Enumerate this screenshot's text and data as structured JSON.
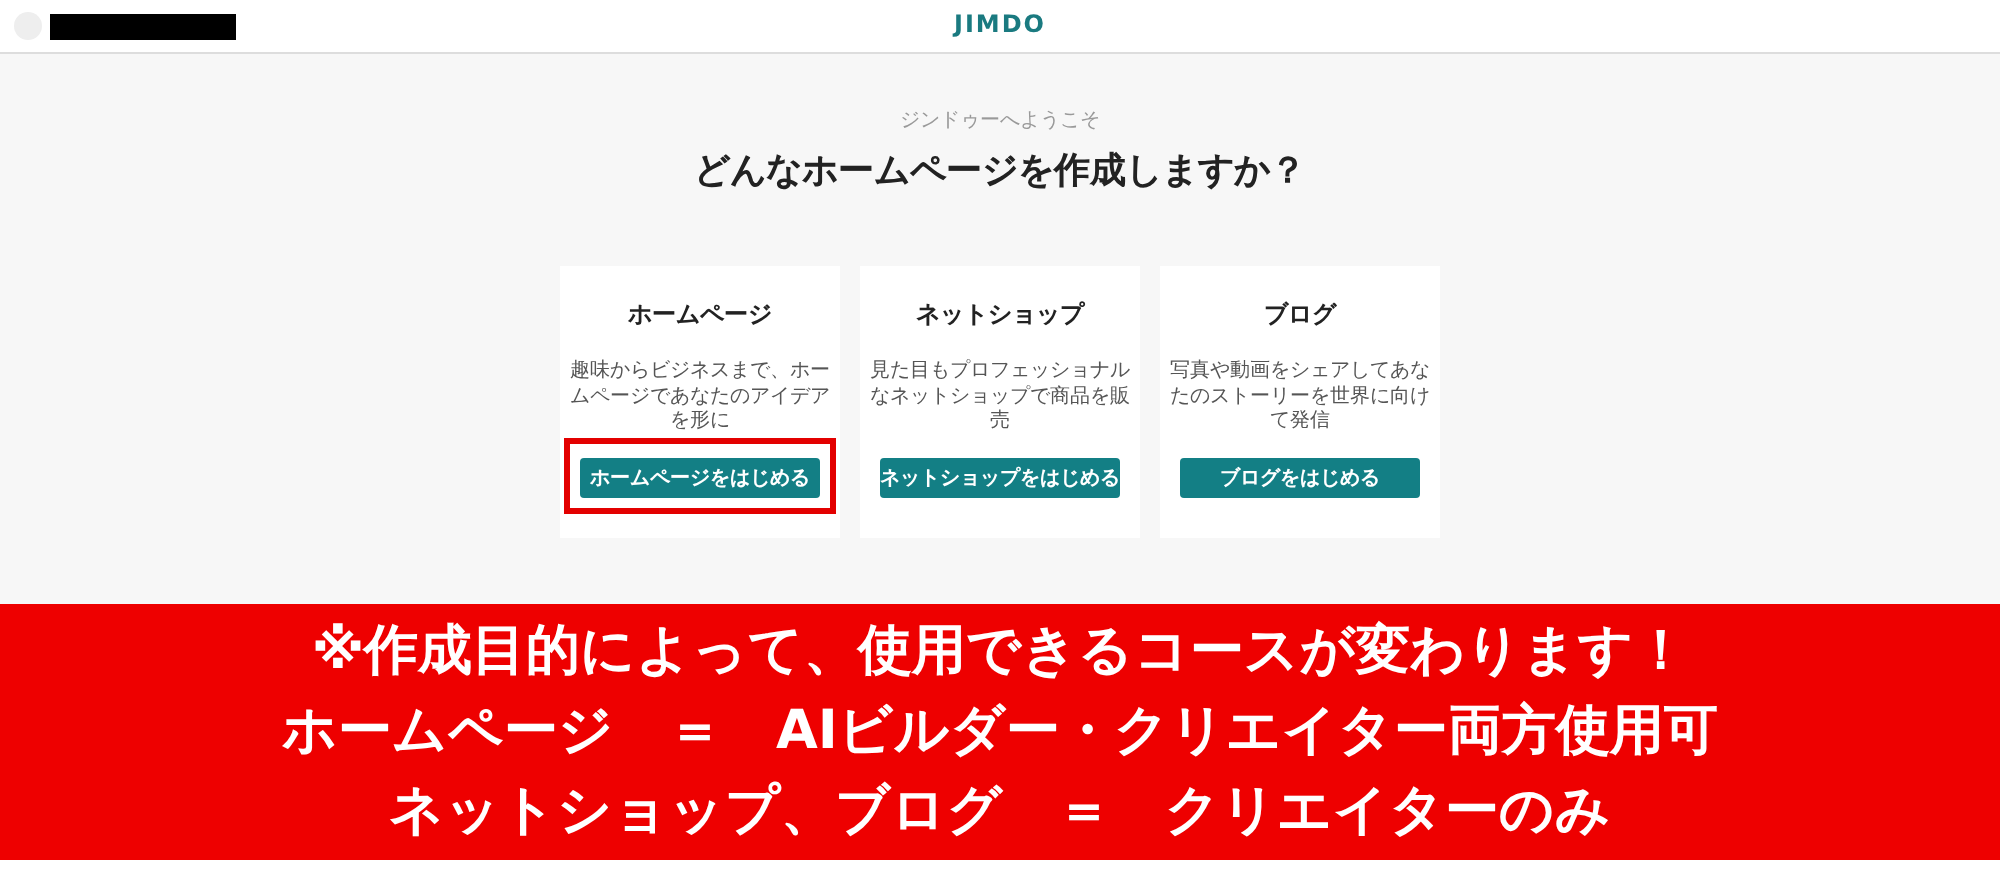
{
  "header": {
    "logo": "JIMDO"
  },
  "welcome": "ジンドゥーへようこそ",
  "title": "どんなホームページを作成しますか？",
  "cards": [
    {
      "title": "ホームページ",
      "description": "趣味からビジネスまで、ホームページであなたのアイデアを形に",
      "button": "ホームページをはじめる",
      "highlighted": true
    },
    {
      "title": "ネットショップ",
      "description": "見た目もプロフェッショナルなネットショップで商品を販売",
      "button": "ネットショップをはじめる",
      "highlighted": false
    },
    {
      "title": "ブログ",
      "description": "写真や動画をシェアしてあなたのストーリーを世界に向けて発信",
      "button": "ブログをはじめる",
      "highlighted": false
    }
  ],
  "banner": {
    "lines": [
      "※作成目的によって、使用できるコースが変わります！",
      "ホームページ　＝　AIビルダー・クリエイター両方使用可",
      "ネットショップ、ブログ　＝　クリエイターのみ"
    ]
  }
}
